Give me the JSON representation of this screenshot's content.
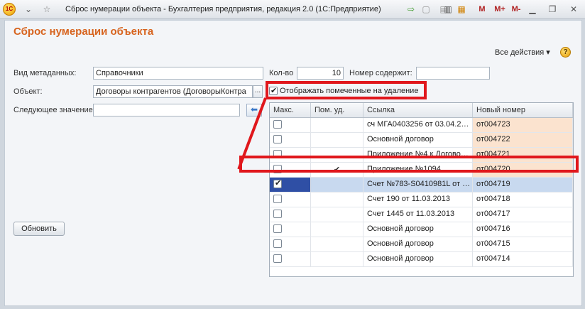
{
  "window": {
    "logo": "1С",
    "title": "Сброс нумерации объекта - Бухгалтерия предприятия, редакция 2.0  (1С:Предприятие)",
    "memory_buttons": [
      "M",
      "M+",
      "M-"
    ]
  },
  "form": {
    "title": "Сброс нумерации объекта",
    "all_actions": "Все действия ▾",
    "help": "?"
  },
  "fields": {
    "metadata_kind_label": "Вид метаданных:",
    "metadata_kind_value": "Справочники",
    "count_label": "Кол-во",
    "count_value": "10",
    "number_contains_label": "Номер содержит:",
    "number_contains_value": "",
    "object_label": "Объект:",
    "object_value": "Договоры контрагентов (ДоговорыКонтра",
    "object_select": "...",
    "next_value_label": "Следующее значение:",
    "next_value_value": "",
    "show_deleted_label": "Отображать помеченные на удаление",
    "show_deleted_checked": true
  },
  "buttons": {
    "refresh": "Обновить"
  },
  "table": {
    "columns": [
      "Макс.",
      "Пом. уд.",
      "Ссылка",
      "Новый номер"
    ],
    "rows": [
      {
        "max": false,
        "deleted": "",
        "ref": "сч МГА0403256 от 03.04.2…",
        "new_number": "от004723",
        "highlight": true
      },
      {
        "max": false,
        "deleted": "",
        "ref": "Основной договор",
        "new_number": "от004722",
        "highlight": true
      },
      {
        "max": false,
        "deleted": "",
        "ref": "Приложение №4 к Догово…",
        "new_number": "от004721",
        "highlight": true
      },
      {
        "max": false,
        "deleted": "✔",
        "ref": "Приложение №1094",
        "new_number": "от004720",
        "highlight": true
      },
      {
        "max": true,
        "deleted": "",
        "ref": "Счет №783-S0410981L от …",
        "new_number": "от004719",
        "highlight": false,
        "selected": true
      },
      {
        "max": false,
        "deleted": "",
        "ref": "Счет 190 от 11.03.2013",
        "new_number": "от004718",
        "highlight": false
      },
      {
        "max": false,
        "deleted": "",
        "ref": "Счет 1445 от 11.03.2013",
        "new_number": "от004717",
        "highlight": false
      },
      {
        "max": false,
        "deleted": "",
        "ref": "Основной договор",
        "new_number": "от004716",
        "highlight": false
      },
      {
        "max": false,
        "deleted": "",
        "ref": "Основной договор",
        "new_number": "от004715",
        "highlight": false
      },
      {
        "max": false,
        "deleted": "",
        "ref": "Основной договор",
        "new_number": "от004714",
        "highlight": false
      }
    ]
  },
  "colors": {
    "accent_title": "#d7641f",
    "annotation_red": "#e0171c",
    "new_number_highlight": "#fbe3cf",
    "selection": "#c8d9ef"
  }
}
